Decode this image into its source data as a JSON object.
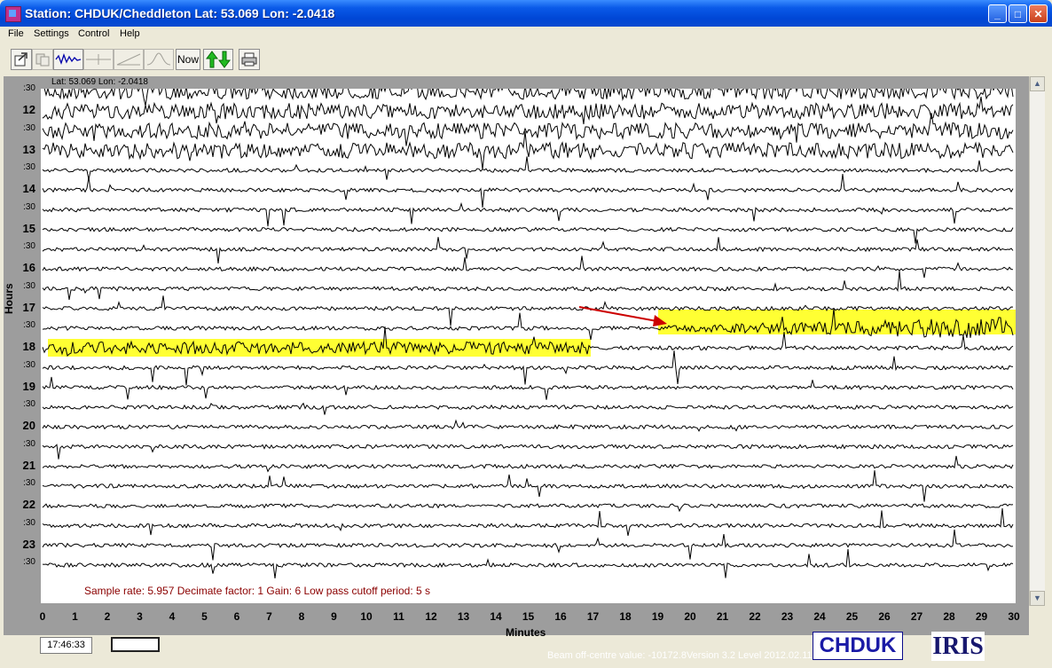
{
  "window": {
    "title": "Station: CHDUK/Cheddleton Lat: 53.069 Lon: -2.0418",
    "controls": {
      "minimize": "_",
      "maximize": "□",
      "close": "✕"
    }
  },
  "menu": [
    "File",
    "Settings",
    "Control",
    "Help"
  ],
  "toolbar": {
    "now_label": "Now",
    "icons": [
      "open-file-icon",
      "copy-icon",
      "waveform-icon",
      "filter-icon",
      "ramp-icon",
      "bell-curve-icon",
      "now-button",
      "up-down-arrows-icon",
      "print-icon"
    ]
  },
  "plot": {
    "location_label": "Lat: 53.069 Lon: -2.0418",
    "y_axis_label": "Hours",
    "x_axis_label": "Minutes",
    "row_labels": [
      ":30",
      "12",
      ":30",
      "13",
      ":30",
      "14",
      ":30",
      "15",
      ":30",
      "16",
      ":30",
      "17",
      ":30",
      "18",
      ":30",
      "19",
      ":30",
      "20",
      ":30",
      "21",
      ":30",
      "22",
      ":30",
      "23",
      ":30"
    ],
    "x_ticks": [
      "0",
      "1",
      "2",
      "3",
      "4",
      "5",
      "6",
      "7",
      "8",
      "9",
      "10",
      "11",
      "12",
      "13",
      "14",
      "15",
      "16",
      "17",
      "18",
      "19",
      "20",
      "21",
      "22",
      "23",
      "24",
      "25",
      "26",
      "27",
      "28",
      "29",
      "30"
    ],
    "info_line": "Sample rate: 5.957  Decimate factor: 1  Gain: 6  Low pass cutoff period: 5 s",
    "highlight_color": "#ffff33",
    "trace_color": "#000000",
    "arrow_color": "#cc0000"
  },
  "status": {
    "clock": "17:46:33",
    "beam_text": "Beam off-centre value: -10172.8Version 3.2 Level 2012.02.11"
  },
  "logos": {
    "chduk": "CHDUK",
    "iris": "IRIS"
  }
}
